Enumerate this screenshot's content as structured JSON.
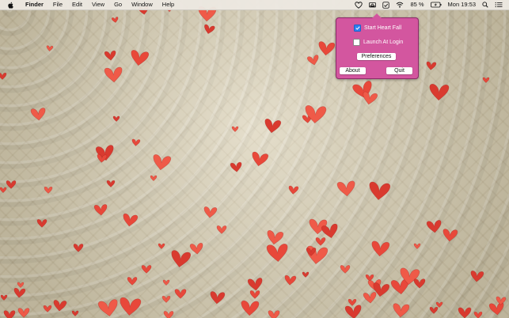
{
  "menubar": {
    "app_name": "Finder",
    "menus": [
      "File",
      "Edit",
      "View",
      "Go",
      "Window",
      "Help"
    ],
    "status": {
      "battery_percent": "85 %",
      "clock": "Mon 19:53"
    },
    "icons": [
      "apple-logo-icon",
      "heart-icon",
      "cloud-drive-icon",
      "checkmark-box-icon",
      "wifi-icon",
      "battery-charging-icon",
      "spotlight-search-icon",
      "notification-list-icon"
    ]
  },
  "popover": {
    "start_heart_fall": {
      "label": "Start Heart Fall",
      "checked": true
    },
    "launch_at_login": {
      "label": "Launch At Login",
      "checked": false
    },
    "preferences_label": "Preferences",
    "about_label": "About",
    "quit_label": "Quit"
  },
  "colors": {
    "popover_bg": "#d3569f",
    "heart": "#e8483a",
    "wallpaper": "#d7cdb0"
  }
}
